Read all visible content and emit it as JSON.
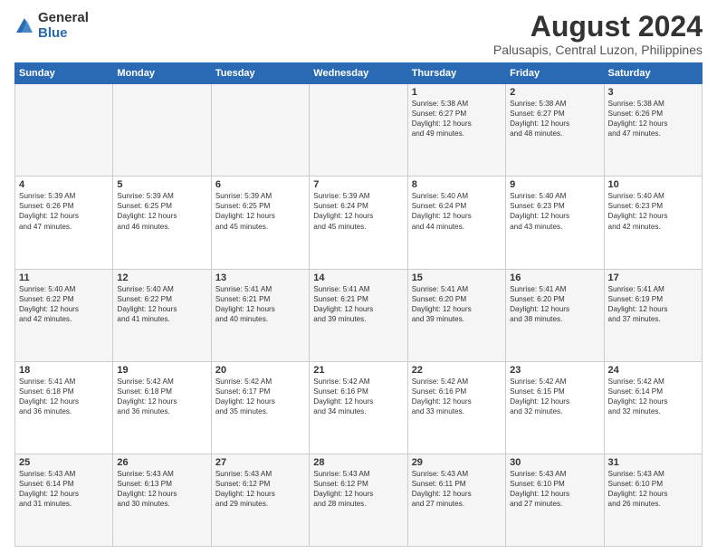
{
  "logo": {
    "general": "General",
    "blue": "Blue"
  },
  "title": "August 2024",
  "subtitle": "Palusapis, Central Luzon, Philippines",
  "days_of_week": [
    "Sunday",
    "Monday",
    "Tuesday",
    "Wednesday",
    "Thursday",
    "Friday",
    "Saturday"
  ],
  "weeks": [
    [
      {
        "day": "",
        "info": ""
      },
      {
        "day": "",
        "info": ""
      },
      {
        "day": "",
        "info": ""
      },
      {
        "day": "",
        "info": ""
      },
      {
        "day": "1",
        "info": "Sunrise: 5:38 AM\nSunset: 6:27 PM\nDaylight: 12 hours\nand 49 minutes."
      },
      {
        "day": "2",
        "info": "Sunrise: 5:38 AM\nSunset: 6:27 PM\nDaylight: 12 hours\nand 48 minutes."
      },
      {
        "day": "3",
        "info": "Sunrise: 5:38 AM\nSunset: 6:26 PM\nDaylight: 12 hours\nand 47 minutes."
      }
    ],
    [
      {
        "day": "4",
        "info": "Sunrise: 5:39 AM\nSunset: 6:26 PM\nDaylight: 12 hours\nand 47 minutes."
      },
      {
        "day": "5",
        "info": "Sunrise: 5:39 AM\nSunset: 6:25 PM\nDaylight: 12 hours\nand 46 minutes."
      },
      {
        "day": "6",
        "info": "Sunrise: 5:39 AM\nSunset: 6:25 PM\nDaylight: 12 hours\nand 45 minutes."
      },
      {
        "day": "7",
        "info": "Sunrise: 5:39 AM\nSunset: 6:24 PM\nDaylight: 12 hours\nand 45 minutes."
      },
      {
        "day": "8",
        "info": "Sunrise: 5:40 AM\nSunset: 6:24 PM\nDaylight: 12 hours\nand 44 minutes."
      },
      {
        "day": "9",
        "info": "Sunrise: 5:40 AM\nSunset: 6:23 PM\nDaylight: 12 hours\nand 43 minutes."
      },
      {
        "day": "10",
        "info": "Sunrise: 5:40 AM\nSunset: 6:23 PM\nDaylight: 12 hours\nand 42 minutes."
      }
    ],
    [
      {
        "day": "11",
        "info": "Sunrise: 5:40 AM\nSunset: 6:22 PM\nDaylight: 12 hours\nand 42 minutes."
      },
      {
        "day": "12",
        "info": "Sunrise: 5:40 AM\nSunset: 6:22 PM\nDaylight: 12 hours\nand 41 minutes."
      },
      {
        "day": "13",
        "info": "Sunrise: 5:41 AM\nSunset: 6:21 PM\nDaylight: 12 hours\nand 40 minutes."
      },
      {
        "day": "14",
        "info": "Sunrise: 5:41 AM\nSunset: 6:21 PM\nDaylight: 12 hours\nand 39 minutes."
      },
      {
        "day": "15",
        "info": "Sunrise: 5:41 AM\nSunset: 6:20 PM\nDaylight: 12 hours\nand 39 minutes."
      },
      {
        "day": "16",
        "info": "Sunrise: 5:41 AM\nSunset: 6:20 PM\nDaylight: 12 hours\nand 38 minutes."
      },
      {
        "day": "17",
        "info": "Sunrise: 5:41 AM\nSunset: 6:19 PM\nDaylight: 12 hours\nand 37 minutes."
      }
    ],
    [
      {
        "day": "18",
        "info": "Sunrise: 5:41 AM\nSunset: 6:18 PM\nDaylight: 12 hours\nand 36 minutes."
      },
      {
        "day": "19",
        "info": "Sunrise: 5:42 AM\nSunset: 6:18 PM\nDaylight: 12 hours\nand 36 minutes."
      },
      {
        "day": "20",
        "info": "Sunrise: 5:42 AM\nSunset: 6:17 PM\nDaylight: 12 hours\nand 35 minutes."
      },
      {
        "day": "21",
        "info": "Sunrise: 5:42 AM\nSunset: 6:16 PM\nDaylight: 12 hours\nand 34 minutes."
      },
      {
        "day": "22",
        "info": "Sunrise: 5:42 AM\nSunset: 6:16 PM\nDaylight: 12 hours\nand 33 minutes."
      },
      {
        "day": "23",
        "info": "Sunrise: 5:42 AM\nSunset: 6:15 PM\nDaylight: 12 hours\nand 32 minutes."
      },
      {
        "day": "24",
        "info": "Sunrise: 5:42 AM\nSunset: 6:14 PM\nDaylight: 12 hours\nand 32 minutes."
      }
    ],
    [
      {
        "day": "25",
        "info": "Sunrise: 5:43 AM\nSunset: 6:14 PM\nDaylight: 12 hours\nand 31 minutes."
      },
      {
        "day": "26",
        "info": "Sunrise: 5:43 AM\nSunset: 6:13 PM\nDaylight: 12 hours\nand 30 minutes."
      },
      {
        "day": "27",
        "info": "Sunrise: 5:43 AM\nSunset: 6:12 PM\nDaylight: 12 hours\nand 29 minutes."
      },
      {
        "day": "28",
        "info": "Sunrise: 5:43 AM\nSunset: 6:12 PM\nDaylight: 12 hours\nand 28 minutes."
      },
      {
        "day": "29",
        "info": "Sunrise: 5:43 AM\nSunset: 6:11 PM\nDaylight: 12 hours\nand 27 minutes."
      },
      {
        "day": "30",
        "info": "Sunrise: 5:43 AM\nSunset: 6:10 PM\nDaylight: 12 hours\nand 27 minutes."
      },
      {
        "day": "31",
        "info": "Sunrise: 5:43 AM\nSunset: 6:10 PM\nDaylight: 12 hours\nand 26 minutes."
      }
    ]
  ]
}
